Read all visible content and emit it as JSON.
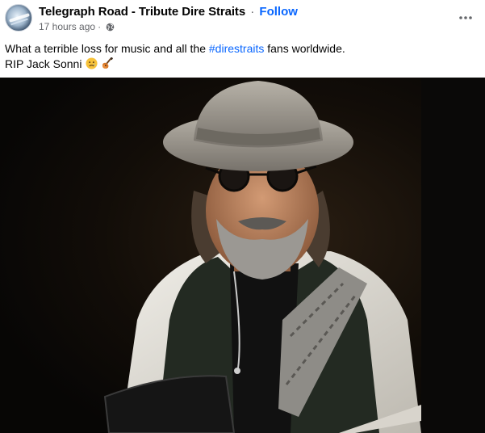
{
  "post": {
    "page_name": "Telegraph Road - Tribute Dire Straits",
    "separator": "·",
    "follow_label": "Follow",
    "time_ago": "17 hours ago",
    "meta_separator": "·",
    "privacy_icon": "globe-icon",
    "more_icon": "more-horizontal-icon",
    "text_line1_pre": "What a terrible loss for music and all the ",
    "hashtag": "#direstraits",
    "text_line1_post": " fans worldwide.",
    "text_line2": "RIP Jack Sonni",
    "emojis": [
      "sad-face-emoji",
      "guitar-emoji"
    ]
  },
  "colors": {
    "link_blue": "#0866ff",
    "secondary_text": "#65676b",
    "primary_text": "#050505"
  }
}
